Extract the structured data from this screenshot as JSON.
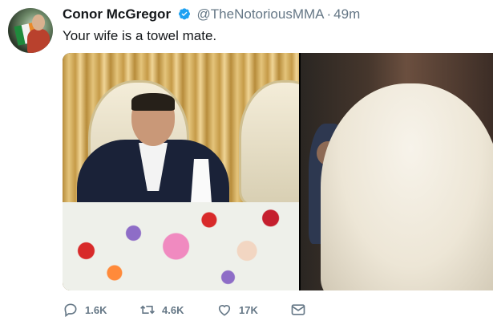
{
  "tweet": {
    "author_name": "Conor McGregor",
    "handle": "@TheNotoriousMMA",
    "separator": "·",
    "time": "49m",
    "text": "Your wife is a towel mate.",
    "verified": true
  },
  "actions": {
    "reply_count": "1.6K",
    "retweet_count": "4.6K",
    "like_count": "17K"
  },
  "icons": {
    "reply": "reply-icon",
    "retweet": "retweet-icon",
    "like": "heart-icon",
    "message": "envelope-icon",
    "verified": "verified-badge-icon"
  },
  "colors": {
    "verified_blue": "#1da1f2",
    "secondary_text": "#657786",
    "primary_text": "#14171a"
  }
}
